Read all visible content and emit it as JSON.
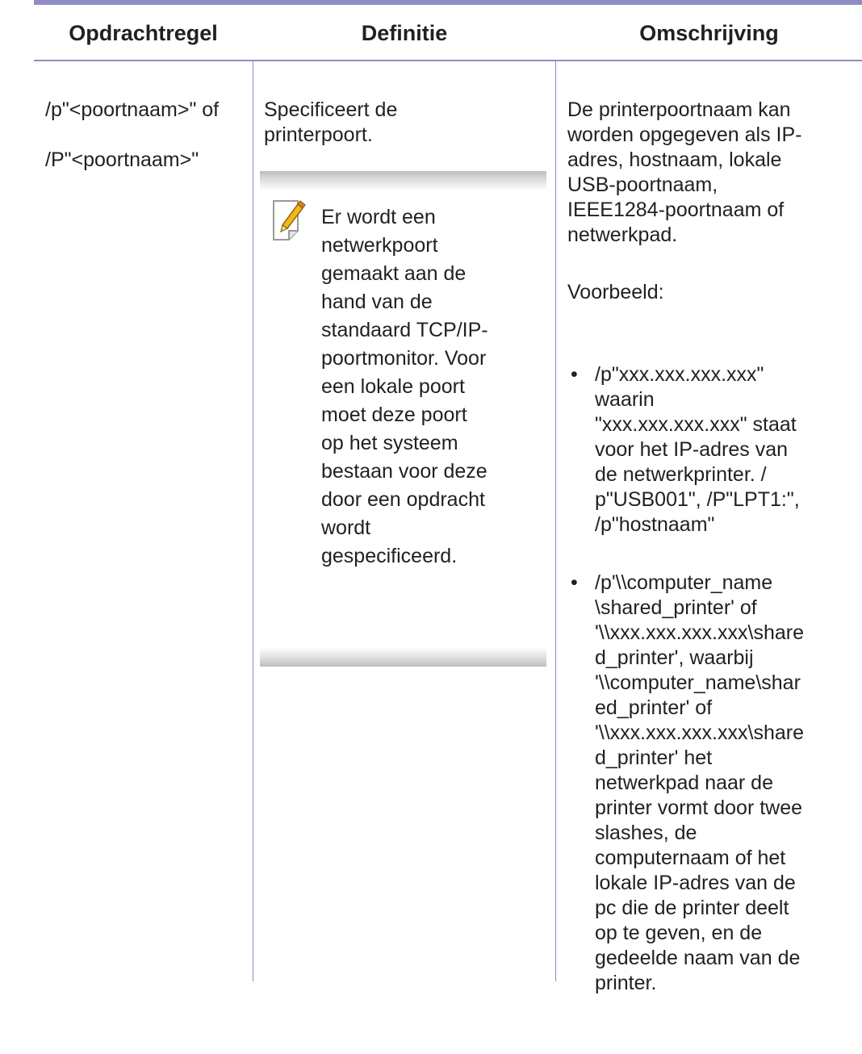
{
  "table": {
    "headers": [
      "Opdrachtregel",
      "Definitie",
      "Omschrijving"
    ],
    "row": {
      "command_lines": [
        "/p\"<poortnaam>\" of",
        "/P\"<poortnaam>\""
      ],
      "definition": "Specificeert de\nprinterpoort.",
      "note": {
        "icon": "pencil-note-icon",
        "text": "Er wordt een\nnetwerkpoort\ngemaakt aan de\nhand van de\nstandaard TCP/IP-\npoortmonitor. Voor\neen lokale poort\nmoet deze poort\nop het systeem\nbestaan voor deze\ndoor een opdracht\nwordt\ngespecificeerd."
      },
      "description": {
        "intro": "De printerpoortnaam kan\nworden opgegeven als IP-\nadres, hostnaam, lokale\nUSB-poortnaam,\nIEEE1284-poortnaam of\nnetwerkpad.",
        "example_label": "Voorbeeld:",
        "bullets": [
          "/p\"xxx.xxx.xxx.xxx\"\nwaarin\n\"xxx.xxx.xxx.xxx\" staat\nvoor het IP-adres van\nde netwerkprinter. /\np\"USB001\", /P\"LPT1:\",\n/p\"hostnaam\"",
          "/p'\\\\computer_name\n\\shared_printer' of\n'\\\\xxx.xxx.xxx.xxx\\share\nd_printer', waarbij\n'\\\\computer_name\\shar\ned_printer' of\n'\\\\xxx.xxx.xxx.xxx\\share\nd_printer' het\nnetwerkpad naar de\nprinter vormt door twee\nslashes, de\ncomputernaam of het\nlokale IP-adres van de\npc die de printer deelt\nop te geven, en de\ngedeelde naam van de\nprinter."
        ]
      }
    }
  },
  "colors": {
    "rule": "#8e8cc3",
    "text": "#231f20",
    "note_band": "#bdbdbd"
  }
}
